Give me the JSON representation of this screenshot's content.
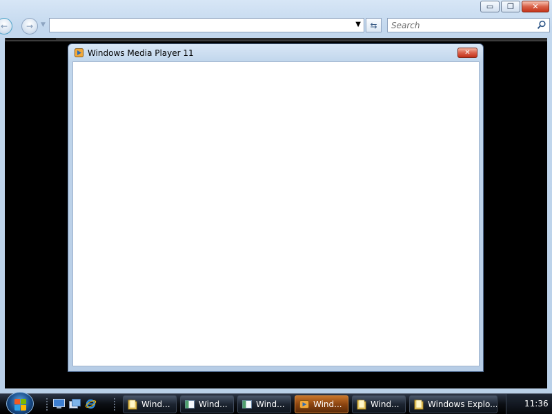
{
  "explorer": {
    "caption_buttons": {
      "minimize": "▭",
      "restore": "❐",
      "close": "✕"
    },
    "address": {
      "value": ""
    },
    "search": {
      "placeholder": "Search"
    }
  },
  "dialog": {
    "title": "Windows Media Player 11",
    "close_glyph": "✕"
  },
  "taskbar": {
    "tasks": [
      {
        "label": "Wind...",
        "icon": "folder-icon"
      },
      {
        "label": "Wind...",
        "icon": "window-icon"
      },
      {
        "label": "Wind...",
        "icon": "window-icon"
      },
      {
        "label": "Wind...",
        "icon": "media-player-icon",
        "active": true
      },
      {
        "label": "Wind...",
        "icon": "folder-icon"
      },
      {
        "label": "Windows Explo...",
        "icon": "folder-icon"
      }
    ],
    "quick_launch": [
      "show-desktop-icon",
      "switch-windows-icon",
      "internet-explorer-icon"
    ],
    "clock": "11:36"
  },
  "colors": {
    "accent": "#c8752a",
    "frame": "#c3d8ee",
    "taskbar": "#0c0f14"
  }
}
